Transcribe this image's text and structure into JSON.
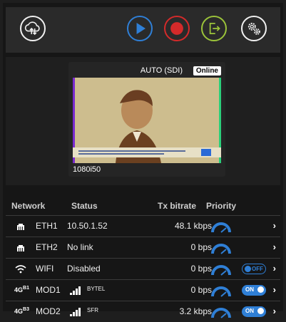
{
  "toolbar": {
    "buttons": [
      {
        "name": "upload",
        "icon": "cloud-upload-icon",
        "color": "#f0f0f0"
      },
      {
        "name": "play",
        "icon": "play-icon",
        "color": "#2f7fd6"
      },
      {
        "name": "record",
        "icon": "record-icon",
        "color": "#d42a2a"
      },
      {
        "name": "export",
        "icon": "export-icon",
        "color": "#9bc33a"
      },
      {
        "name": "settings",
        "icon": "gears-icon",
        "color": "#f0f0f0"
      }
    ]
  },
  "preview": {
    "mode": "AUTO (SDI)",
    "status_badge": "Online",
    "resolution": "1080i50"
  },
  "network_table": {
    "headers": {
      "network": "Network",
      "status": "Status",
      "tx_bitrate": "Tx bitrate",
      "priority": "Priority"
    },
    "rows": [
      {
        "icon": "ethernet-icon",
        "name": "ETH1",
        "status": "10.50.1.52",
        "tx_bitrate": "48.1 kbps"
      },
      {
        "icon": "ethernet-icon",
        "name": "ETH2",
        "status": "No link",
        "tx_bitrate": "0 bps"
      },
      {
        "icon": "wifi-icon",
        "name": "WIFI",
        "status": "Disabled",
        "tx_bitrate": "0 bps",
        "toggle": "OFF"
      },
      {
        "icon": "signal-icon",
        "modem_tech": "4G",
        "modem_slot": "B1",
        "name": "MOD1",
        "carrier": "BYTEL",
        "tx_bitrate": "0 bps",
        "toggle": "ON"
      },
      {
        "icon": "signal-icon",
        "modem_tech": "4G",
        "modem_slot": "B3",
        "name": "MOD2",
        "carrier": "SFR",
        "tx_bitrate": "3.2 kbps",
        "toggle": "ON"
      }
    ]
  },
  "colors": {
    "accent": "#2f7fd6",
    "record": "#d42a2a",
    "export": "#9bc33a",
    "background": "#161616"
  }
}
